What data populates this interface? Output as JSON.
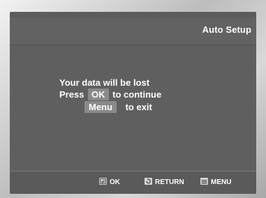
{
  "header": {
    "title": "Auto Setup"
  },
  "message": {
    "line1": "Your data will be lost",
    "line2_prefix": "Press",
    "line2_key": "OK",
    "line2_suffix": "to continue",
    "line3_key": "Menu",
    "line3_suffix": "to exit"
  },
  "footer": {
    "ok_label": "OK",
    "return_label": "RETURN",
    "menu_label": "MENU",
    "icons": [
      "enter-icon",
      "return-icon",
      "menu-icon"
    ]
  }
}
